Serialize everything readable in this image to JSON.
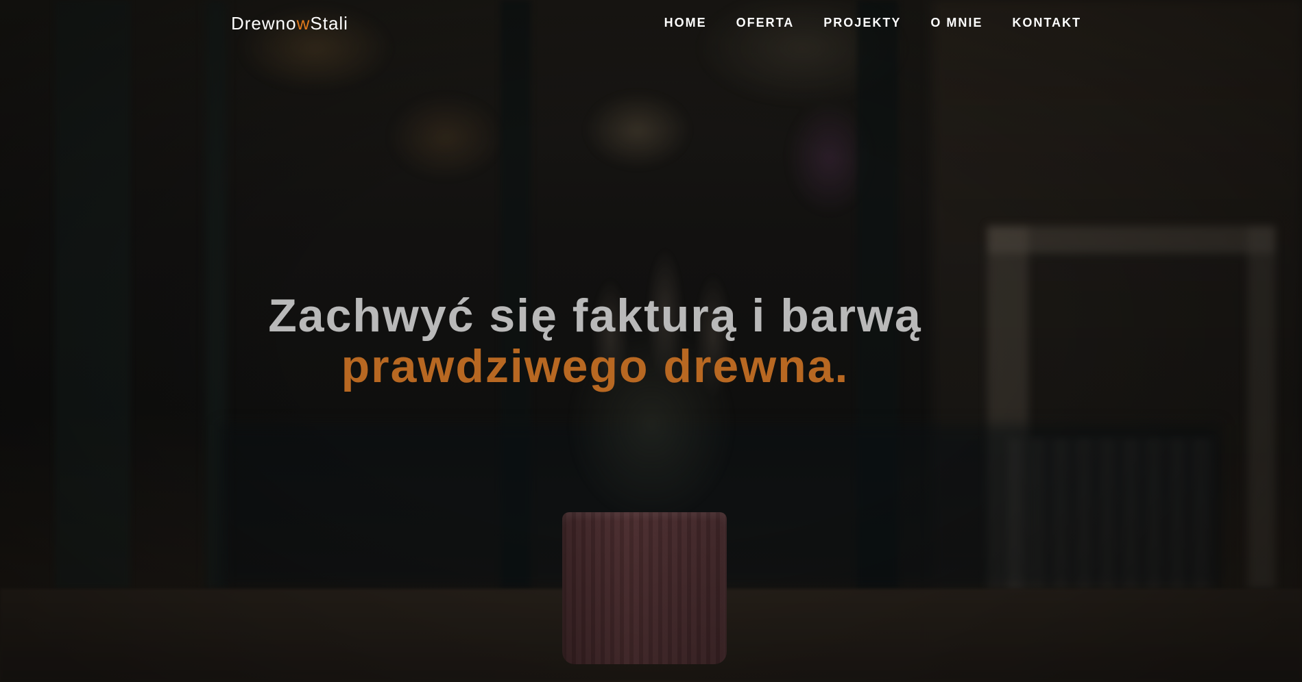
{
  "brand": {
    "part1": "Drewno",
    "accent": "w",
    "part2": "Stali",
    "accent_color": "#e07a1c"
  },
  "nav": {
    "items": [
      {
        "label": "HOME"
      },
      {
        "label": "OFERTA"
      },
      {
        "label": "PROJEKTY"
      },
      {
        "label": "O MNIE"
      },
      {
        "label": "KONTAKT"
      }
    ]
  },
  "hero": {
    "headline_line1": "Zachwyć się fakturą i barwą",
    "headline_line2": "prawdziwego drewna.",
    "line1_color": "#b9b9b9",
    "line2_color": "#b86822"
  }
}
